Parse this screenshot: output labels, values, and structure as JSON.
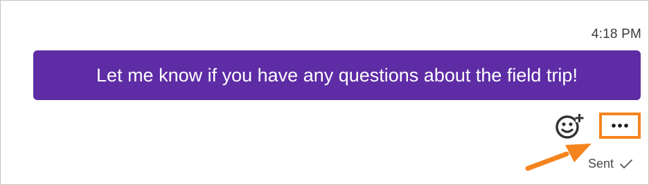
{
  "message": {
    "timestamp": "4:18 PM",
    "text": "Let me know if you have any questions about the field trip!",
    "status": "Sent"
  },
  "actions": {
    "add_reaction_icon": "emoji-plus-icon",
    "more_options_icon": "more-horizontal-icon"
  },
  "colors": {
    "bubble": "#5e2ca5",
    "highlight": "#f5841f",
    "arrow": "#f5841f"
  }
}
